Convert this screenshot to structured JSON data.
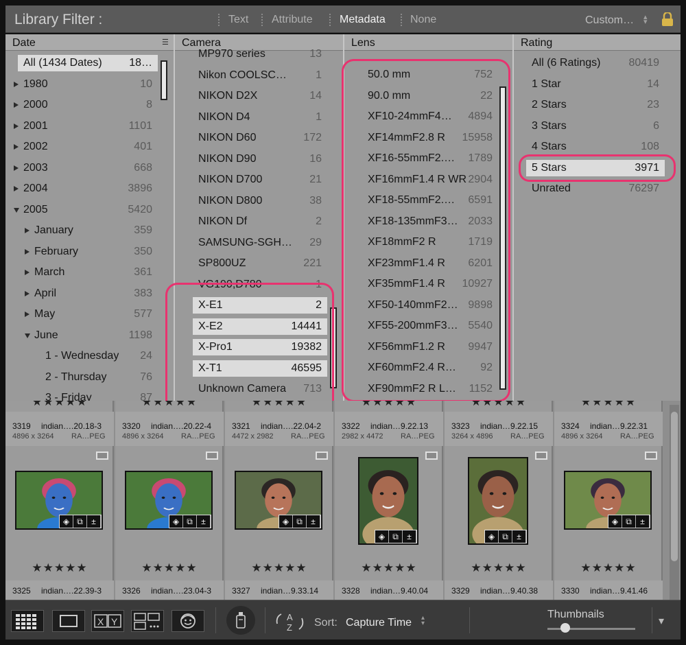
{
  "filter_bar": {
    "title": "Library Filter :",
    "tabs": [
      {
        "label": "Text"
      },
      {
        "label": "Attribute"
      },
      {
        "label": "Metadata"
      },
      {
        "label": "None"
      }
    ],
    "active_tab": "Metadata",
    "preset": "Custom…"
  },
  "columns": {
    "date": {
      "header": "Date",
      "rows": [
        {
          "label": "All (1434 Dates)",
          "count": "18…",
          "selected": true
        },
        {
          "label": "1980",
          "count": "10"
        },
        {
          "label": "2000",
          "count": "8"
        },
        {
          "label": "2001",
          "count": "1101"
        },
        {
          "label": "2002",
          "count": "401"
        },
        {
          "label": "2003",
          "count": "668"
        },
        {
          "label": "2004",
          "count": "3896"
        },
        {
          "label": "2005",
          "count": "5420"
        },
        {
          "label": "January",
          "count": "359"
        },
        {
          "label": "February",
          "count": "350"
        },
        {
          "label": "March",
          "count": "361"
        },
        {
          "label": "April",
          "count": "383"
        },
        {
          "label": "May",
          "count": "577"
        },
        {
          "label": "June",
          "count": "1198"
        },
        {
          "label": "1 - Wednesday",
          "count": "24"
        },
        {
          "label": "2 - Thursday",
          "count": "76"
        },
        {
          "label": "3 - Friday",
          "count": "87"
        }
      ]
    },
    "camera": {
      "header": "Camera",
      "rows": [
        {
          "label": "MP970 series",
          "count": "13"
        },
        {
          "label": "Nikon COOLSC…",
          "count": "1"
        },
        {
          "label": "NIKON D2X",
          "count": "14"
        },
        {
          "label": "NIKON D4",
          "count": "1"
        },
        {
          "label": "NIKON D60",
          "count": "172"
        },
        {
          "label": "NIKON D90",
          "count": "16"
        },
        {
          "label": "NIKON D700",
          "count": "21"
        },
        {
          "label": "NIKON D800",
          "count": "38"
        },
        {
          "label": "NIKON Df",
          "count": "2"
        },
        {
          "label": "SAMSUNG-SGH…",
          "count": "29"
        },
        {
          "label": "SP800UZ",
          "count": "221"
        },
        {
          "label": "VG190,D780",
          "count": "1"
        },
        {
          "label": "X-E1",
          "count": "2",
          "selected": true
        },
        {
          "label": "X-E2",
          "count": "14441",
          "selected": true
        },
        {
          "label": "X-Pro1",
          "count": "19382",
          "selected": true
        },
        {
          "label": "X-T1",
          "count": "46595",
          "selected": true
        },
        {
          "label": "Unknown Camera",
          "count": "713"
        }
      ]
    },
    "lens": {
      "header": "Lens",
      "rows": [
        {
          "label": "50.0 mm",
          "count": "752"
        },
        {
          "label": "90.0 mm",
          "count": "22"
        },
        {
          "label": "XF10-24mmF4…",
          "count": "4894"
        },
        {
          "label": "XF14mmF2.8 R",
          "count": "15958"
        },
        {
          "label": "XF16-55mmF2.…",
          "count": "1789"
        },
        {
          "label": "XF16mmF1.4 R WR",
          "count": "2904"
        },
        {
          "label": "XF18-55mmF2.…",
          "count": "6591"
        },
        {
          "label": "XF18-135mmF3…",
          "count": "2033"
        },
        {
          "label": "XF18mmF2 R",
          "count": "1719"
        },
        {
          "label": "XF23mmF1.4 R",
          "count": "6201"
        },
        {
          "label": "XF35mmF1.4 R",
          "count": "10927"
        },
        {
          "label": "XF50-140mmF2…",
          "count": "9898"
        },
        {
          "label": "XF55-200mmF3…",
          "count": "5540"
        },
        {
          "label": "XF56mmF1.2 R",
          "count": "9947"
        },
        {
          "label": "XF60mmF2.4 R…",
          "count": "92"
        },
        {
          "label": "XF90mmF2 R L…",
          "count": "1152"
        }
      ]
    },
    "rating": {
      "header": "Rating",
      "rows": [
        {
          "label": "All (6 Ratings)",
          "count": "80419"
        },
        {
          "label": "1 Star",
          "count": "14"
        },
        {
          "label": "2 Stars",
          "count": "23"
        },
        {
          "label": "3 Stars",
          "count": "6"
        },
        {
          "label": "4 Stars",
          "count": "108"
        },
        {
          "label": "5 Stars",
          "count": "3971",
          "selected": true
        },
        {
          "label": "Unrated",
          "count": "76297"
        }
      ]
    }
  },
  "grid": {
    "top_row": [
      {
        "num": "3319",
        "name": "indian….20.18-3",
        "dims": "4896 x 3264",
        "type": "RA…PEG"
      },
      {
        "num": "3320",
        "name": "indian….20.22-4",
        "dims": "4896 x 3264",
        "type": "RA…PEG"
      },
      {
        "num": "3321",
        "name": "indian….22.04-2",
        "dims": "4472 x 2982",
        "type": "RA…PEG"
      },
      {
        "num": "3322",
        "name": "indian…9.22.13",
        "dims": "2982 x 4472",
        "type": "RA…PEG"
      },
      {
        "num": "3323",
        "name": "indian…9.22.15",
        "dims": "3264 x 4896",
        "type": "RA…PEG"
      },
      {
        "num": "3324",
        "name": "indian…9.22.31",
        "dims": "4896 x 3264",
        "type": "RA…PEG"
      }
    ],
    "stars": "★★★★★",
    "bottom_row": [
      {
        "num": "3325",
        "name": "indian….22.39-3"
      },
      {
        "num": "3326",
        "name": "indian….23.04-3"
      },
      {
        "num": "3327",
        "name": "indian…9.33.14"
      },
      {
        "num": "3328",
        "name": "indian…9.40.04"
      },
      {
        "num": "3329",
        "name": "indian…9.40.38"
      },
      {
        "num": "3330",
        "name": "indian…9.41.46"
      }
    ]
  },
  "toolbar": {
    "sort_label": "Sort:",
    "sort_value": "Capture Time",
    "thumbnails_label": "Thumbnails",
    "thumbnail_size": 0.2
  },
  "colors": {
    "highlight": "#e8336f"
  }
}
